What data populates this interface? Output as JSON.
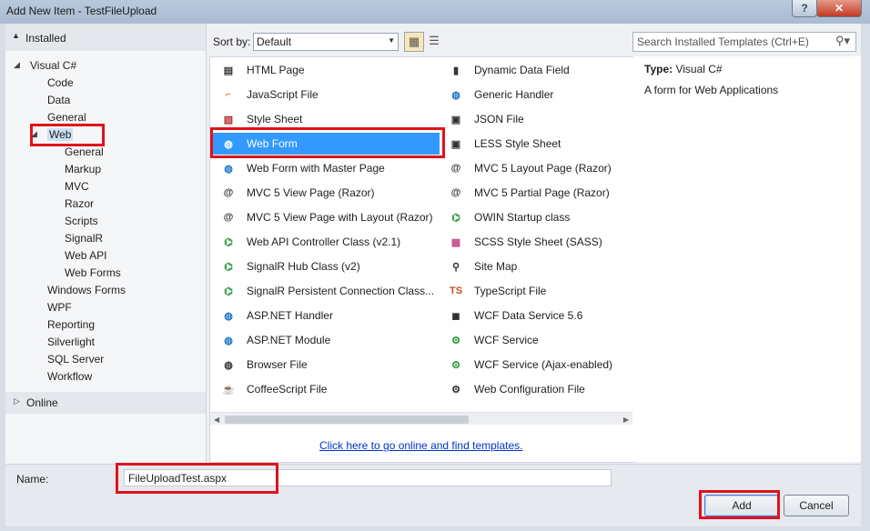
{
  "window": {
    "title": "Add New Item - TestFileUpload",
    "help_label": "?",
    "close_label": "✕"
  },
  "tree": {
    "installed_label": "Installed",
    "root": "Visual C#",
    "children": [
      "Code",
      "Data",
      "General"
    ],
    "web": "Web",
    "web_children": [
      "General",
      "Markup",
      "MVC",
      "Razor",
      "Scripts",
      "SignalR",
      "Web API",
      "Web Forms"
    ],
    "after_web": [
      "Windows Forms",
      "WPF",
      "Reporting",
      "Silverlight",
      "SQL Server",
      "Workflow"
    ],
    "online_label": "Online"
  },
  "sort": {
    "label": "Sort by:",
    "value": "Default"
  },
  "search": {
    "placeholder": "Search Installed Templates (Ctrl+E)"
  },
  "templates_left": [
    {
      "label": "HTML Page",
      "icon": "html-page-icon"
    },
    {
      "label": "JavaScript File",
      "icon": "javascript-icon"
    },
    {
      "label": "Style Sheet",
      "icon": "stylesheet-icon"
    },
    {
      "label": "Web Form",
      "icon": "web-form-icon"
    },
    {
      "label": "Web Form with Master Page",
      "icon": "web-form-icon"
    },
    {
      "label": "MVC 5 View Page (Razor)",
      "icon": "razor-page-icon"
    },
    {
      "label": "MVC 5 View Page with Layout (Razor)",
      "icon": "razor-page-icon"
    },
    {
      "label": "Web API Controller Class (v2.1)",
      "icon": "csharp-class-icon"
    },
    {
      "label": "SignalR Hub Class (v2)",
      "icon": "csharp-class-icon"
    },
    {
      "label": "SignalR Persistent Connection Class...",
      "icon": "csharp-class-icon"
    },
    {
      "label": "ASP.NET Handler",
      "icon": "globe-icon"
    },
    {
      "label": "ASP.NET Module",
      "icon": "globe-icon"
    },
    {
      "label": "Browser File",
      "icon": "browser-file-icon"
    },
    {
      "label": "CoffeeScript File",
      "icon": "coffeescript-icon"
    }
  ],
  "templates_right": [
    {
      "label": "Dynamic Data Field",
      "icon": "data-field-icon"
    },
    {
      "label": "Generic Handler",
      "icon": "globe-icon"
    },
    {
      "label": "JSON File",
      "icon": "json-icon"
    },
    {
      "label": "LESS Style Sheet",
      "icon": "less-icon"
    },
    {
      "label": "MVC 5 Layout Page (Razor)",
      "icon": "razor-page-icon"
    },
    {
      "label": "MVC 5 Partial Page (Razor)",
      "icon": "razor-page-icon"
    },
    {
      "label": "OWIN Startup class",
      "icon": "csharp-class-icon"
    },
    {
      "label": "SCSS Style Sheet (SASS)",
      "icon": "scss-icon"
    },
    {
      "label": "Site Map",
      "icon": "sitemap-icon"
    },
    {
      "label": "TypeScript File",
      "icon": "typescript-icon"
    },
    {
      "label": "WCF Data Service 5.6",
      "icon": "wcf-data-icon"
    },
    {
      "label": "WCF Service",
      "icon": "wcf-service-icon"
    },
    {
      "label": "WCF Service (Ajax-enabled)",
      "icon": "wcf-service-icon"
    },
    {
      "label": "Web Configuration File",
      "icon": "config-file-icon"
    }
  ],
  "online_link": "Click here to go online and find templates.",
  "details": {
    "type_label": "Type:",
    "type_value": "Visual C#",
    "description": "A form for Web Applications"
  },
  "name": {
    "label": "Name:",
    "value": "FileUploadTest.aspx"
  },
  "buttons": {
    "add": "Add",
    "cancel": "Cancel"
  },
  "colors": {
    "highlight": "#e0121b",
    "selection": "#3399ff",
    "link": "#0033cc"
  }
}
